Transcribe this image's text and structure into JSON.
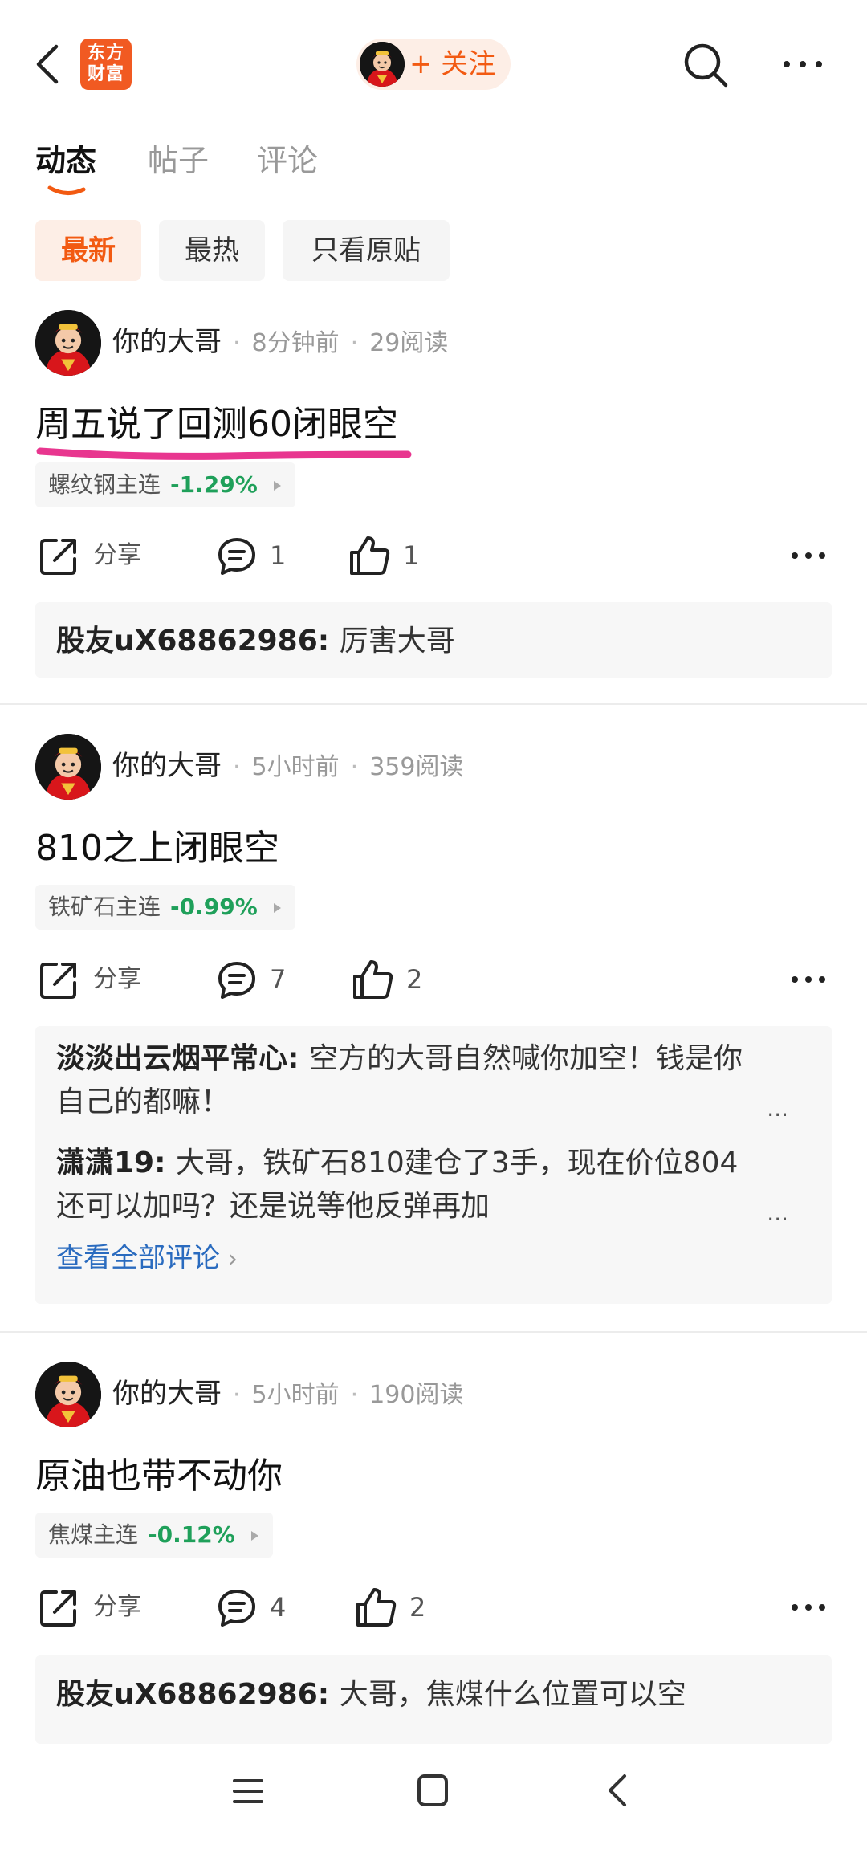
{
  "header": {
    "logo_line1": "东方",
    "logo_line2": "财富",
    "follow_label": "+ 关注"
  },
  "tabs": [
    {
      "label": "动态",
      "active": true
    },
    {
      "label": "帖子",
      "active": false
    },
    {
      "label": "评论",
      "active": false
    }
  ],
  "filters": [
    {
      "label": "最新",
      "active": true
    },
    {
      "label": "最热",
      "active": false
    },
    {
      "label": "只看原贴",
      "active": false
    }
  ],
  "colors": {
    "brand": "#f15a22",
    "accent": "#f25a12",
    "down_green": "#1fa05a",
    "link_blue": "#2a6bbf",
    "highlight_pink": "#e8368f"
  },
  "posts": [
    {
      "author": "你的大哥",
      "time": "8分钟前",
      "reads": "29阅读",
      "text": "周五说了回测60闭眼空",
      "tag_name": "螺纹钢主连",
      "tag_change": "-1.29%",
      "share_label": "分享",
      "comment_count": "1",
      "like_count": "1",
      "comments": [
        {
          "user": "股友uX68862986",
          "sep": ": ",
          "text": "厉害大哥"
        }
      ]
    },
    {
      "author": "你的大哥",
      "time": "5小时前",
      "reads": "359阅读",
      "text": "810之上闭眼空",
      "tag_name": "铁矿石主连",
      "tag_change": "-0.99%",
      "share_label": "分享",
      "comment_count": "7",
      "like_count": "2",
      "comments": [
        {
          "user": "淡淡出云烟平常心",
          "sep": ": ",
          "text": "空方的大哥自然喊你加空！钱是你自己的都嘛！",
          "ellipsis": "..."
        },
        {
          "user": "潇潇19",
          "sep": ": ",
          "text": "大哥，铁矿石810建仓了3手，现在价位804还可以加吗？还是说等他反弹再加",
          "ellipsis": "..."
        }
      ],
      "view_all": "查看全部评论"
    },
    {
      "author": "你的大哥",
      "time": "5小时前",
      "reads": "190阅读",
      "text": "原油也带不动你",
      "tag_name": "焦煤主连",
      "tag_change": "-0.12%",
      "share_label": "分享",
      "comment_count": "4",
      "like_count": "2",
      "comments": [
        {
          "user": "股友uX68862986",
          "sep": ": ",
          "text": "大哥，焦煤什么位置可以空"
        }
      ]
    }
  ]
}
